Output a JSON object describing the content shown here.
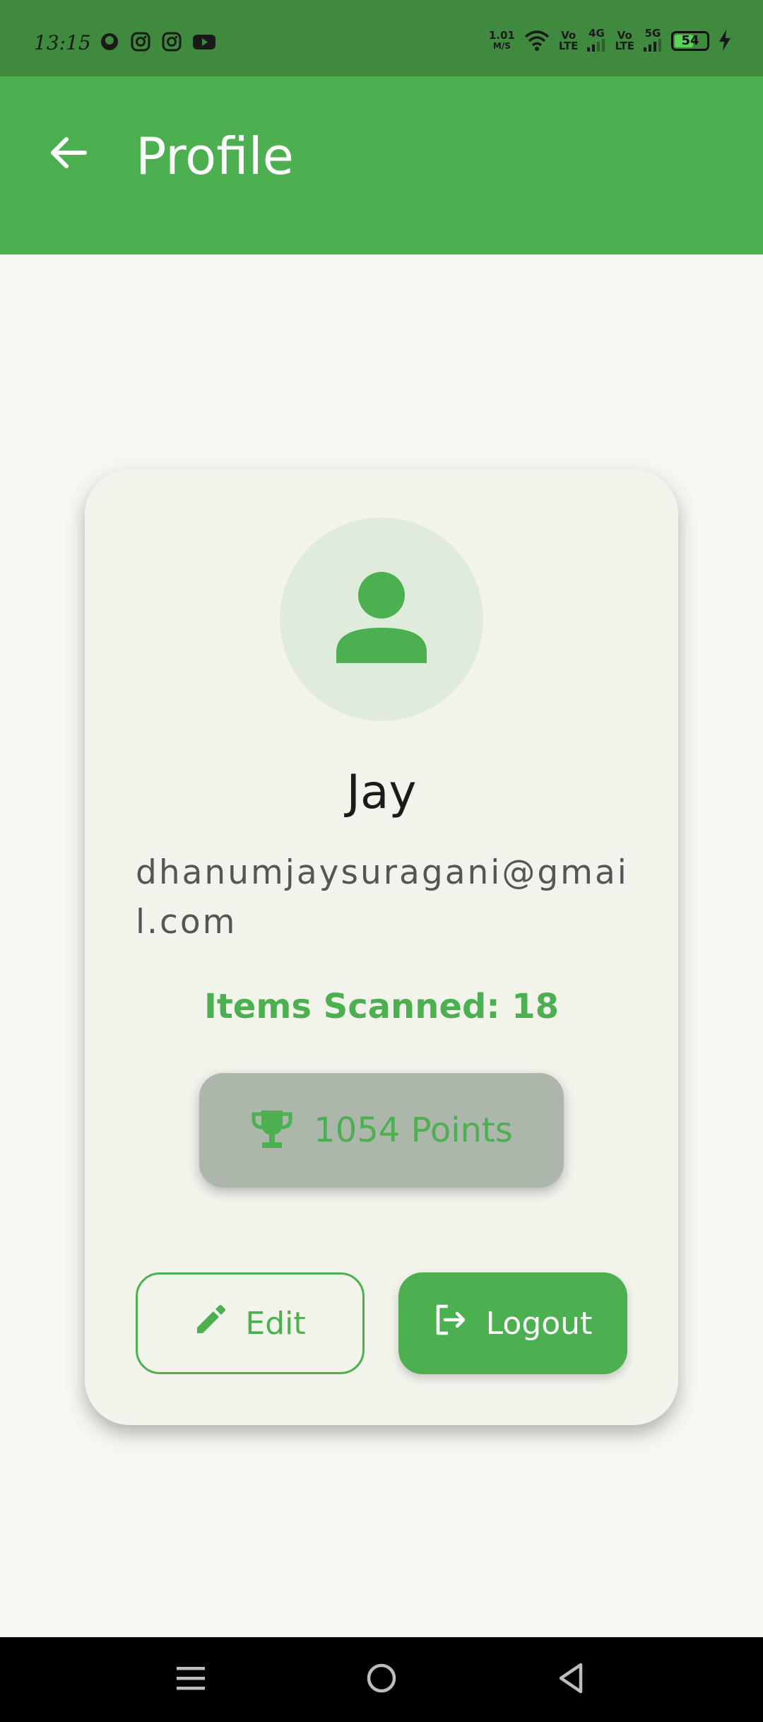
{
  "status_bar": {
    "time": "13:15",
    "network_speed": "1.01",
    "network_speed_unit": "M/S",
    "sim1_label_top": "Vo",
    "sim1_label_bottom": "LTE",
    "sim1_network": "4G",
    "sim2_label_top": "Vo",
    "sim2_label_bottom": "LTE",
    "sim2_network": "5G",
    "battery": "54",
    "left_icons": [
      "notification-app-icon",
      "instagram-icon",
      "instagram-icon",
      "youtube-icon"
    ],
    "right_icons": [
      "wifi-icon",
      "signal-icon",
      "signal-icon",
      "charging-icon"
    ]
  },
  "app_bar": {
    "title": "Profile",
    "back_icon": "arrow-back-icon",
    "color": "#4caf50"
  },
  "profile": {
    "avatar_icon": "person-icon",
    "name": "Jay",
    "email": "dhanumjaysuragani@gmail.com",
    "items_scanned": "Items Scanned: 18",
    "points_icon": "trophy-icon",
    "points": "1054 Points"
  },
  "actions": {
    "edit_label": "Edit",
    "edit_icon": "pencil-icon",
    "logout_label": "Logout",
    "logout_icon": "logout-icon"
  },
  "nav_bar": {
    "items": [
      "menu-icon",
      "home-icon",
      "back-icon"
    ]
  },
  "colors": {
    "primary": "#4caf50",
    "status_bar": "#3f8a3f",
    "background": "#f4f7f2",
    "card": "#f2f4ec"
  }
}
